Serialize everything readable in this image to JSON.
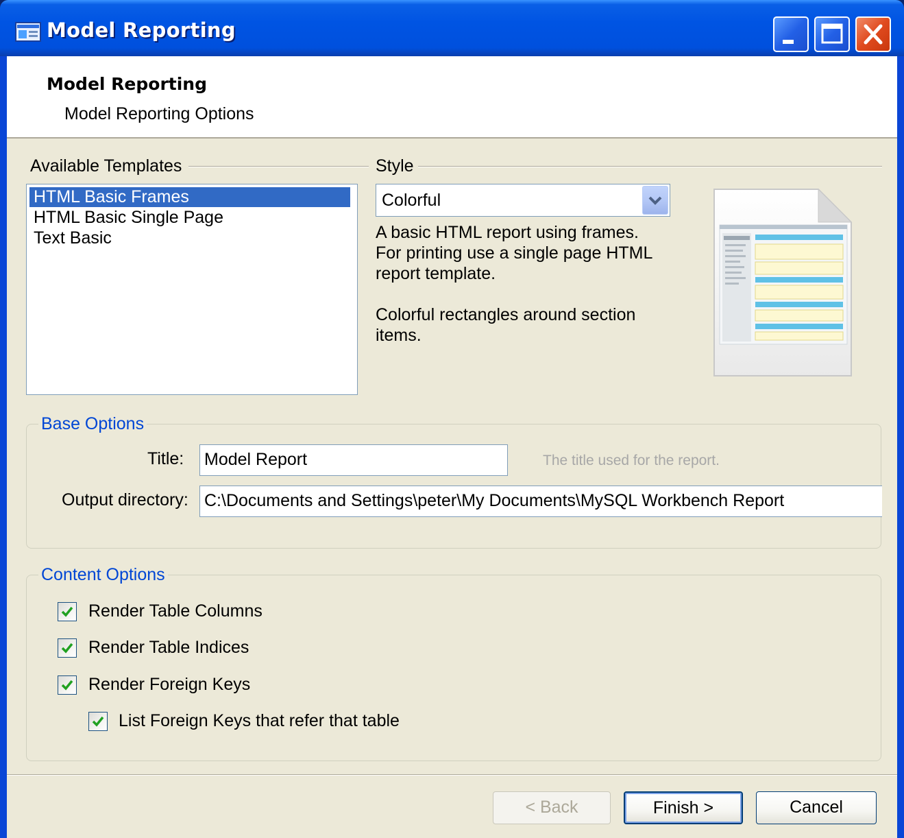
{
  "window": {
    "title": "Model Reporting"
  },
  "header": {
    "title": "Model Reporting",
    "subtitle": "Model Reporting Options"
  },
  "templates": {
    "label": "Available Templates",
    "items": [
      {
        "label": "HTML Basic Frames",
        "selected": true
      },
      {
        "label": "HTML Basic Single Page",
        "selected": false
      },
      {
        "label": "Text Basic",
        "selected": false
      }
    ]
  },
  "style": {
    "label": "Style",
    "selected": "Colorful",
    "description_lines": [
      "A basic HTML report using frames.",
      "For printing use a single page HTML",
      "report template."
    ],
    "detail_lines": [
      "Colorful rectangles around section",
      "items."
    ]
  },
  "base_options": {
    "label": "Base Options",
    "title_label": "Title:",
    "title_value": "Model Report",
    "title_hint": "The title used for the report.",
    "output_label": "Output directory:",
    "output_value": "C:\\Documents and Settings\\peter\\My Documents\\MySQL Workbench Report"
  },
  "content_options": {
    "label": "Content Options",
    "render_columns": {
      "label": "Render Table Columns",
      "checked": true
    },
    "render_indices": {
      "label": "Render Table Indices",
      "checked": true
    },
    "render_fks": {
      "label": "Render Foreign Keys",
      "checked": true
    },
    "list_fks": {
      "label": "List Foreign Keys that refer that table",
      "checked": true
    }
  },
  "buttons": {
    "back": "< Back",
    "finish": "Finish >",
    "cancel": "Cancel"
  },
  "colors": {
    "titlebar": "#0054e3",
    "selection": "#316ac5",
    "group_caption": "#0046d5",
    "dialog_bg": "#ece9d8"
  }
}
